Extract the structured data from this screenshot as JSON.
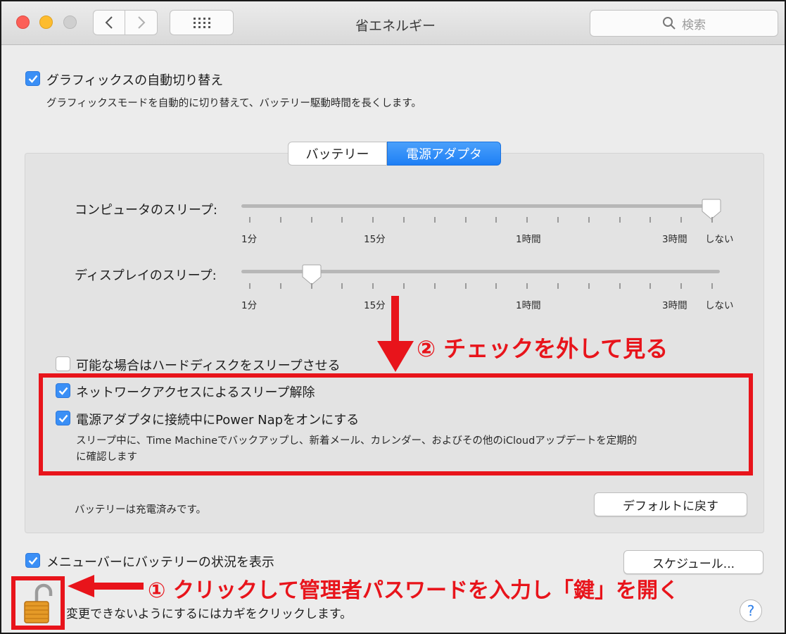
{
  "window": {
    "title": "省エネルギー",
    "search_placeholder": "検索"
  },
  "graphics_switching": {
    "label": "グラフィックスの自動切り替え",
    "description": "グラフィックスモードを自動的に切り替えて、バッテリー駆動時間を長くします。",
    "checked": true
  },
  "tabs": [
    {
      "label": "バッテリー",
      "selected": false
    },
    {
      "label": "電源アダプタ",
      "selected": true
    }
  ],
  "computer_sleep": {
    "label": "コンピュータのスリープ:",
    "value": "しない",
    "tick_labels": [
      "1分",
      "15分",
      "1時間",
      "3時間",
      "しない"
    ]
  },
  "display_sleep": {
    "label": "ディスプレイのスリープ:",
    "value_fraction": 0.14,
    "tick_labels": [
      "1分",
      "15分",
      "1時間",
      "3時間",
      "しない"
    ]
  },
  "options": {
    "disk_sleep": {
      "label": "可能な場合はハードディスクをスリープさせる",
      "checked": false
    },
    "network_wake": {
      "label": "ネットワークアクセスによるスリープ解除",
      "checked": true
    },
    "power_nap": {
      "label": "電源アダプタに接続中にPower Napをオンにする",
      "checked": true,
      "description_line1": "スリープ中に、Time Machineでバックアップし、新着メール、カレンダー、およびその他のiCloudアップデートを定期的",
      "description_line2": "に確認します"
    }
  },
  "battery_status": "バッテリーは充電済みです。",
  "buttons": {
    "restore_defaults": "デフォルトに戻す",
    "schedule": "スケジュール..."
  },
  "menubar_battery": {
    "label": "メニューバーにバッテリーの状況を表示",
    "checked": true
  },
  "lock_text": "変更できないようにするにはカギをクリックします。",
  "help_label": "?",
  "annotations": {
    "step2": "② チェックを外して見る",
    "step1": "① クリックして管理者パスワードを入力し「鍵」を開く"
  },
  "colors": {
    "accent": "#3a8ff6",
    "annotation_red": "#e8141b"
  }
}
